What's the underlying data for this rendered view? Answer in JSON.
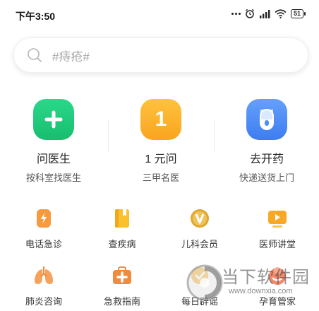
{
  "status_bar": {
    "time": "下午3:50",
    "battery": "51",
    "icons": [
      "more-dots-icon",
      "alarm-icon",
      "signal-icon",
      "wifi-icon",
      "battery-icon"
    ]
  },
  "search": {
    "placeholder": "#痔疮#"
  },
  "primary_services": [
    {
      "icon": "plus-icon",
      "glyph": "+",
      "color": "#22c77a",
      "label": "问医生",
      "sub": "按科室找医生"
    },
    {
      "icon": "one-yuan-icon",
      "glyph": "1",
      "color": "#fbb02c",
      "label": "1 元问",
      "sub": "三甲名医"
    },
    {
      "icon": "pill-icon",
      "glyph": "",
      "color": "#4f8ef7",
      "label": "去开药",
      "sub": "快递送货上门"
    }
  ],
  "secondary_services": [
    {
      "icon": "emergency-phone-icon",
      "label": "电话急诊",
      "color": "#f79a3e"
    },
    {
      "icon": "disease-book-icon",
      "label": "查疾病",
      "color": "#fbc02d"
    },
    {
      "icon": "vip-badge-icon",
      "label": "儿科会员",
      "color": "#e0a72e"
    },
    {
      "icon": "video-lecture-icon",
      "label": "医师讲堂",
      "color": "#f9a825"
    },
    {
      "icon": "lungs-icon",
      "label": "肺炎咨询",
      "color": "#f5a25d"
    },
    {
      "icon": "first-aid-kit-icon",
      "label": "急救指南",
      "color": "#f08a3c"
    },
    {
      "icon": "rumor-icon",
      "label": "每日辟谣",
      "color": "#f7b94a"
    },
    {
      "icon": "parenting-icon",
      "label": "孕育管家",
      "color": "#f28b6c"
    }
  ],
  "watermark": {
    "brand": "当下软件园",
    "url": "www.downxia.com"
  }
}
